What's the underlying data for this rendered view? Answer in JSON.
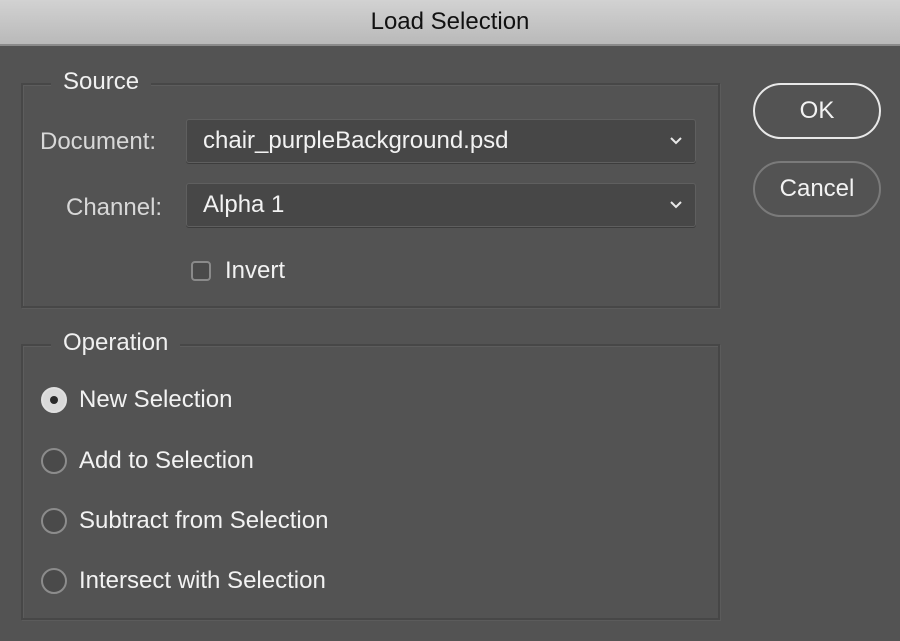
{
  "window": {
    "title": "Load Selection"
  },
  "source": {
    "legend": "Source",
    "document": {
      "label": "Document:",
      "value": "chair_purpleBackground.psd",
      "icon": "chevron-down-icon"
    },
    "channel": {
      "label": "Channel:",
      "value": "Alpha 1",
      "icon": "chevron-down-icon"
    },
    "invert": {
      "label": "Invert",
      "checked": false
    }
  },
  "operation": {
    "legend": "Operation",
    "options": [
      {
        "label": "New Selection",
        "selected": true
      },
      {
        "label": "Add to Selection",
        "selected": false
      },
      {
        "label": "Subtract from Selection",
        "selected": false
      },
      {
        "label": "Intersect with Selection",
        "selected": false
      }
    ]
  },
  "buttons": {
    "ok": "OK",
    "cancel": "Cancel"
  }
}
